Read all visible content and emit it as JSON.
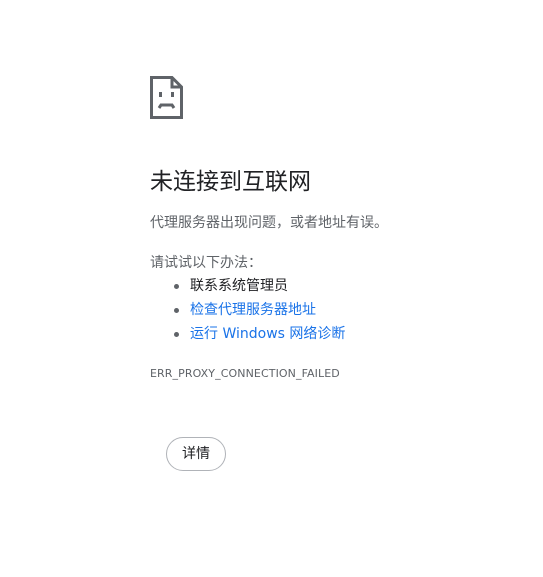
{
  "error_page": {
    "icon": "sad-document-icon",
    "title": "未连接到互联网",
    "description": "代理服务器出现问题，或者地址有误。",
    "try_heading": "请试试以下办法：",
    "suggestions": [
      {
        "label": "联系系统管理员",
        "is_link": false
      },
      {
        "label": "检查代理服务器地址",
        "is_link": true
      },
      {
        "label": "运行 Windows 网络诊断",
        "is_link": true
      }
    ],
    "error_code": "ERR_PROXY_CONNECTION_FAILED",
    "details_button_label": "详情"
  },
  "colors": {
    "text_primary": "#202124",
    "text_secondary": "#5f6368",
    "link": "#1a73e8",
    "background": "#ffffff"
  }
}
